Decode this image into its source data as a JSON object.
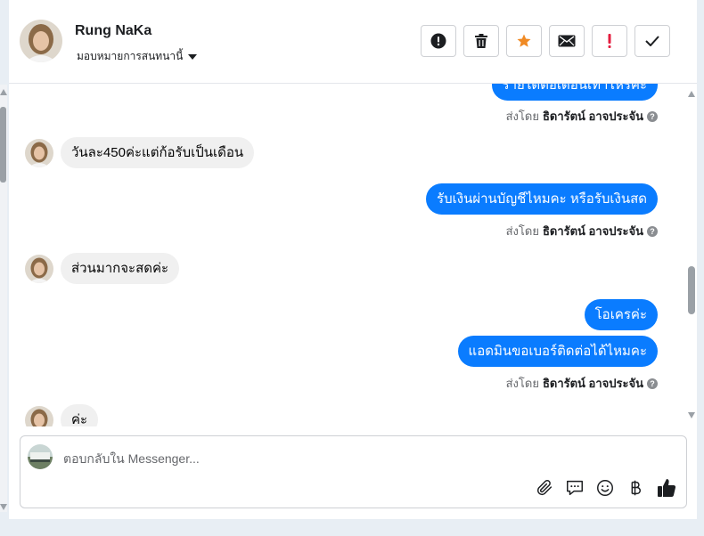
{
  "contact": {
    "name": "Rung NaKa",
    "assign_label": "มอบหมายการสนทนานี้"
  },
  "header_actions": [
    {
      "name": "mark-spam-button",
      "icon": "alert-circle-icon"
    },
    {
      "name": "delete-button",
      "icon": "trash-icon"
    },
    {
      "name": "star-button",
      "icon": "star-icon"
    },
    {
      "name": "mark-unread-button",
      "icon": "envelope-icon"
    },
    {
      "name": "follow-up-button",
      "icon": "exclamation-icon"
    },
    {
      "name": "mark-done-button",
      "icon": "check-icon"
    }
  ],
  "messages": {
    "out_partial": "รายได้ต่อเดือนเท่าไหร่คะ",
    "in_1": "วันละ450ค่ะแต่ก้อรับเป็นเดือน",
    "out_1": "รับเงินผ่านบัญชีไหมคะ หรือรับเงินสด",
    "in_2": "ส่วนมากจะสดค่ะ",
    "out_2": "โอเครค่ะ",
    "out_3": "แอดมินขอเบอร์ติดต่อได้ไหมคะ",
    "in_3": "ค่ะ"
  },
  "sent_by": {
    "prefix": "ส่งโดย",
    "agent": "ธิดารัตน์ อาจประจัน",
    "help": "?"
  },
  "composer": {
    "placeholder": "ตอบกลับใน Messenger..."
  },
  "composer_tools": [
    "paperclip-icon",
    "saved-reply-icon",
    "emoji-icon",
    "baht-icon",
    "thumbs-up-icon"
  ],
  "colors": {
    "accent": "#0a7cff",
    "star": "#f08a24",
    "alert": "#e41e3f"
  }
}
